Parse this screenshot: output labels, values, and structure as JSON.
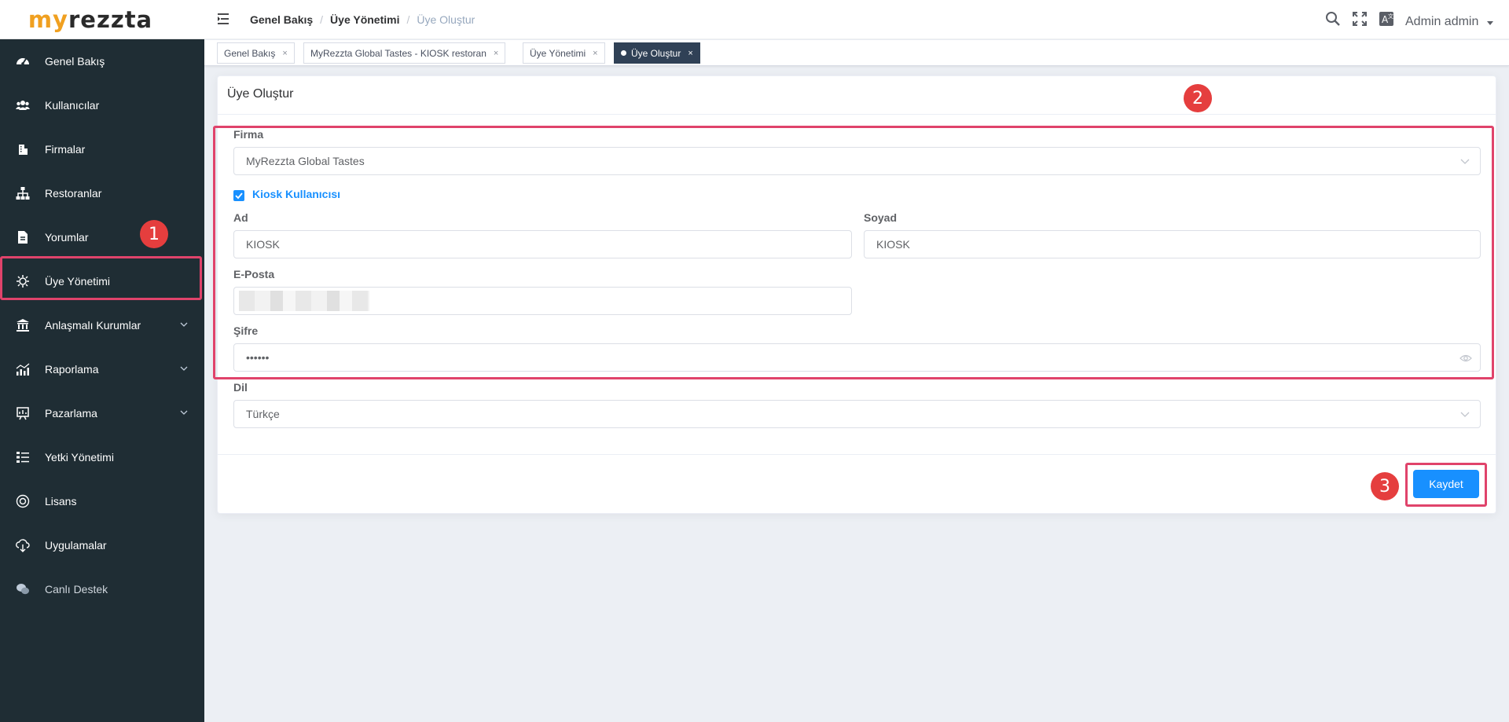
{
  "logo": {
    "part1": "my",
    "part2": "rezzta"
  },
  "sidebar": {
    "items": [
      {
        "label": "Genel Bakış",
        "icon": "dashboard-icon"
      },
      {
        "label": "Kullanıcılar",
        "icon": "users-icon"
      },
      {
        "label": "Firmalar",
        "icon": "building-icon"
      },
      {
        "label": "Restoranlar",
        "icon": "sitemap-icon"
      },
      {
        "label": "Yorumlar",
        "icon": "document-icon"
      },
      {
        "label": "Üye Yönetimi",
        "icon": "member-icon"
      },
      {
        "label": "Anlaşmalı Kurumlar",
        "icon": "bank-icon"
      },
      {
        "label": "Raporlama",
        "icon": "chart-icon"
      },
      {
        "label": "Pazarlama",
        "icon": "marketing-icon"
      },
      {
        "label": "Yetki Yönetimi",
        "icon": "permission-icon"
      },
      {
        "label": "Lisans",
        "icon": "license-icon"
      },
      {
        "label": "Uygulamalar",
        "icon": "cloud-icon"
      },
      {
        "label": "Canlı Destek",
        "icon": "chat-icon"
      }
    ]
  },
  "header": {
    "breadcrumb": [
      "Genel Bakış",
      "Üye Yönetimi",
      "Üye Oluştur"
    ],
    "user": "Admin admin"
  },
  "tabs": [
    {
      "label": "Genel Bakış",
      "close": "×"
    },
    {
      "label": "MyRezzta Global Tastes - KIOSK restoran",
      "close": "×"
    },
    {
      "label": "Üye Yönetimi",
      "close": "×"
    },
    {
      "label": "Üye Oluştur",
      "close": "×",
      "active": true
    }
  ],
  "form": {
    "title": "Üye Oluştur",
    "firma_label": "Firma",
    "firma_value": "MyRezzta Global Tastes",
    "kiosk_label": "Kiosk Kullanıcısı",
    "kiosk_checked": true,
    "ad_label": "Ad",
    "ad_value": "KIOSK",
    "soyad_label": "Soyad",
    "soyad_value": "KIOSK",
    "eposta_label": "E-Posta",
    "sifre_label": "Şifre",
    "sifre_value": "••••••",
    "dil_label": "Dil",
    "dil_value": "Türkçe",
    "save_label": "Kaydet"
  },
  "annotations": [
    "1",
    "2",
    "3"
  ],
  "colors": {
    "accent": "#1890ff",
    "sidebar": "#1f2d34",
    "highlight": "#e0436b",
    "badge": "#e53e3e",
    "logo_orange": "#f0a020"
  }
}
